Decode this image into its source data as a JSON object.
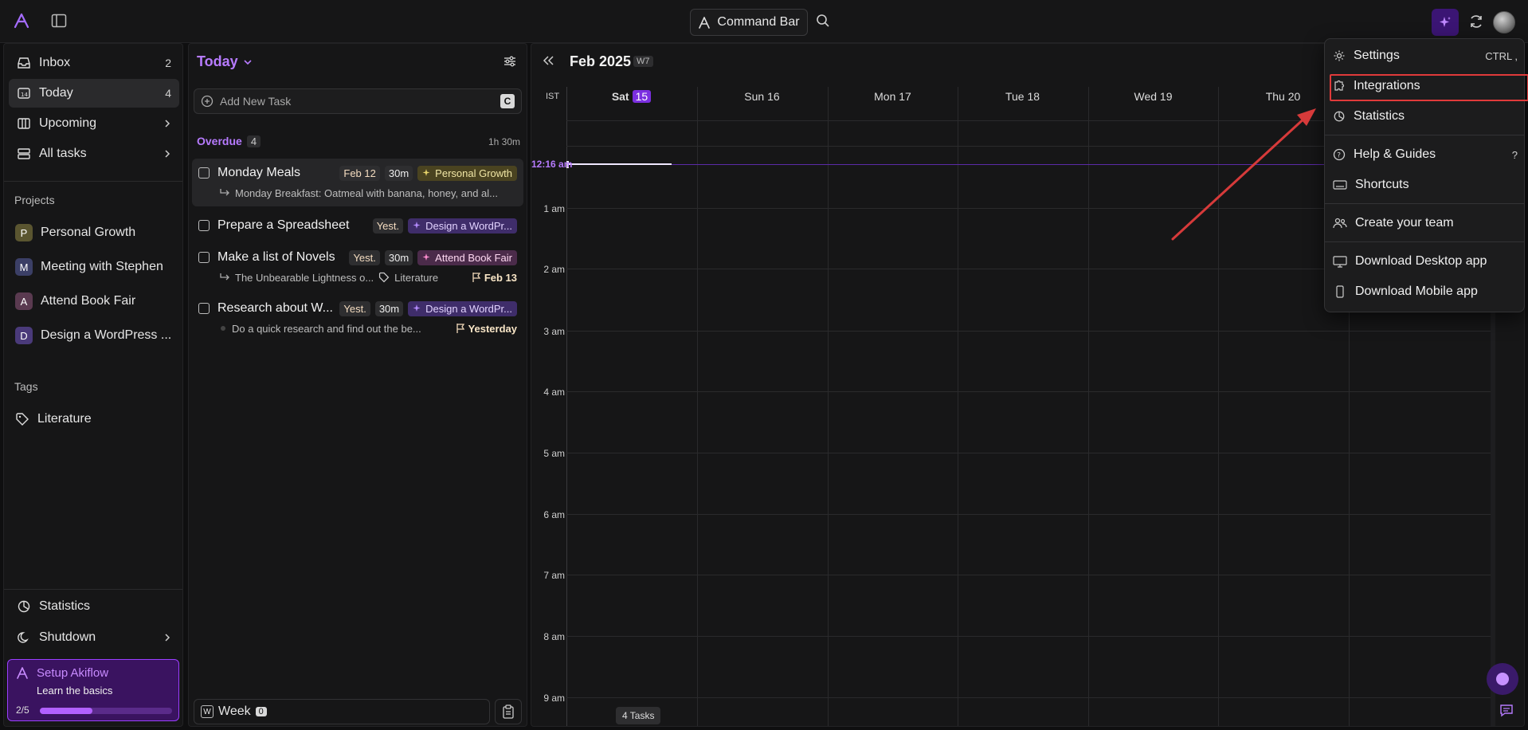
{
  "topbar": {
    "command_bar_label": "Command Bar",
    "icons": [
      "akiflow-logo-icon",
      "sidebar-toggle-icon",
      "search-icon",
      "sparkle-icon",
      "sync-icon",
      "avatar"
    ]
  },
  "sidebar": {
    "nav": [
      {
        "label": "Inbox",
        "count": "2",
        "icon": "inbox-icon"
      },
      {
        "label": "Today",
        "count": "4",
        "icon": "calendar-today-icon"
      },
      {
        "label": "Upcoming",
        "icon": "columns-icon"
      },
      {
        "label": "All tasks",
        "icon": "stack-icon"
      }
    ],
    "projects_title": "Projects",
    "projects": [
      {
        "letter": "P",
        "name": "Personal Growth",
        "color": "#5a5530"
      },
      {
        "letter": "M",
        "name": "Meeting with Stephen",
        "color": "#3b3f66"
      },
      {
        "letter": "A",
        "name": "Attend Book Fair",
        "color": "#5a3a50"
      },
      {
        "letter": "D",
        "name": "Design a WordPress ...",
        "color": "#4a3a7a"
      }
    ],
    "tags_title": "Tags",
    "tags": [
      {
        "name": "Literature"
      }
    ],
    "bottom": [
      {
        "label": "Statistics",
        "icon": "pie-chart-icon"
      },
      {
        "label": "Shutdown",
        "icon": "moon-icon"
      }
    ],
    "setup": {
      "title": "Setup Akiflow",
      "subtitle": "Learn the basics",
      "progress_text": "2/5",
      "progress": 0.4
    }
  },
  "tasklist": {
    "title": "Today",
    "add_placeholder": "Add New Task",
    "add_shortcut": "C",
    "overdue_label": "Overdue",
    "overdue_count": "4",
    "overdue_duration": "1h 30m",
    "tasks": [
      {
        "name": "Monday Meals",
        "date": "Feb 12",
        "duration": "30m",
        "project": "Personal Growth",
        "subtask": "Monday Breakfast: Oatmeal with banana, honey, and al..."
      },
      {
        "name": "Prepare a Spreadsheet",
        "date": "Yest.",
        "project": "Design a WordPr..."
      },
      {
        "name": "Make a list of Novels",
        "date": "Yest.",
        "duration": "30m",
        "project": "Attend Book Fair",
        "subtask": "The Unbearable Lightness o...",
        "tag": "Literature",
        "deadline": "Feb 13"
      },
      {
        "name": "Research about W...",
        "date": "Yest.",
        "duration": "30m",
        "project": "Design a WordPr...",
        "note": "Do a quick research and find out the be...",
        "deadline": "Yesterday"
      }
    ],
    "week_label": "Week",
    "week_icon_letter": "W",
    "week_count": "0"
  },
  "calendar": {
    "month": "Feb 2025",
    "week": "W7",
    "timezone": "IST",
    "days": [
      {
        "name": "Sat",
        "num": "15",
        "today": true
      },
      {
        "name": "Sun",
        "num": "16"
      },
      {
        "name": "Mon",
        "num": "17"
      },
      {
        "name": "Tue",
        "num": "18"
      },
      {
        "name": "Wed",
        "num": "19"
      },
      {
        "name": "Thu",
        "num": "20"
      }
    ],
    "now_label": "12:16 am",
    "hours": [
      "1 am",
      "2 am",
      "3 am",
      "4 am",
      "5 am",
      "6 am",
      "7 am",
      "8 am",
      "9 am"
    ],
    "tasks_pill": "4 Tasks"
  },
  "menu": {
    "items": [
      {
        "label": "Settings",
        "shortcut": "CTRL  ,",
        "icon": "gear-icon"
      },
      {
        "label": "Integrations",
        "icon": "puzzle-icon",
        "highlighted": true
      },
      {
        "label": "Statistics",
        "icon": "pie-chart-icon"
      },
      {
        "label": "Help & Guides",
        "shortcut": "?",
        "icon": "help-circle-icon"
      },
      {
        "label": "Shortcuts",
        "icon": "keyboard-icon"
      },
      {
        "label": "Create your team",
        "icon": "users-icon"
      },
      {
        "label": "Download Desktop app",
        "icon": "monitor-icon"
      },
      {
        "label": "Download Mobile app",
        "icon": "phone-icon"
      }
    ]
  },
  "colors": {
    "accent": "#b77bff",
    "highlight_box": "#e03a3a",
    "arrow": "#d63a3a"
  }
}
